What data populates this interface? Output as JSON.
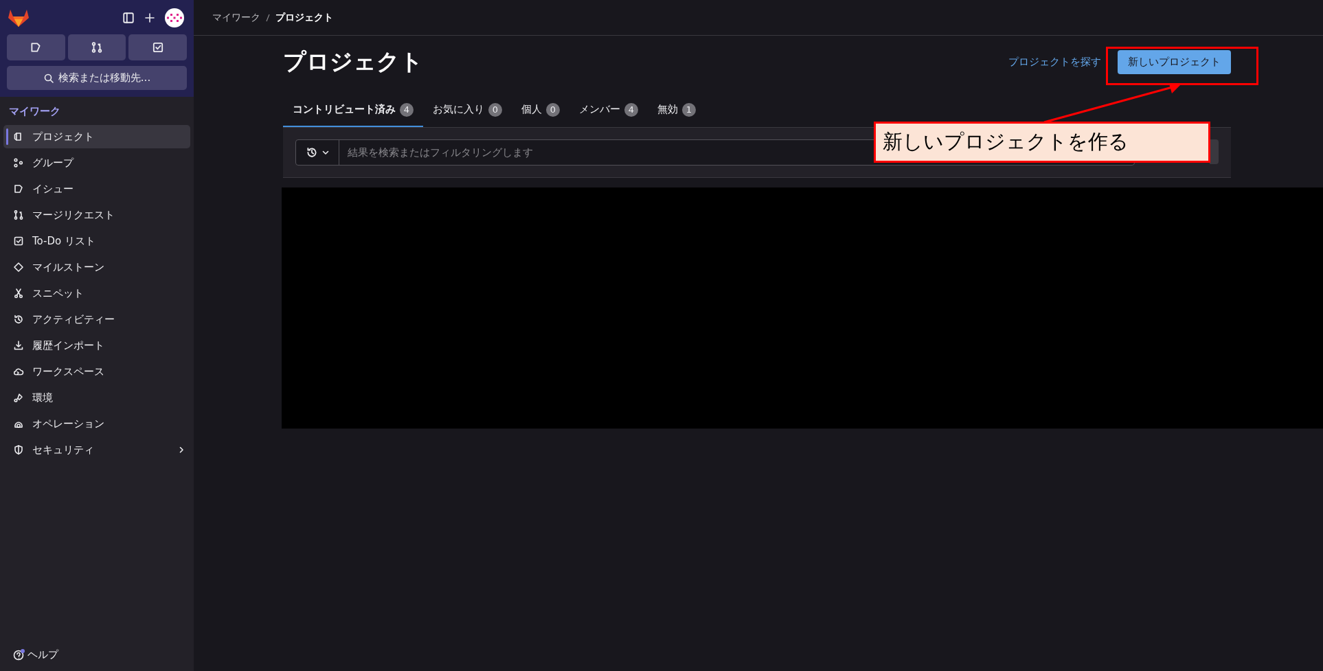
{
  "sidebar": {
    "search": {
      "label": "検索または移動先..."
    },
    "section_title": "マイワーク",
    "items": [
      {
        "label": "プロジェクト",
        "selected": true
      },
      {
        "label": "グループ",
        "selected": false
      },
      {
        "label": "イシュー",
        "selected": false
      },
      {
        "label": "マージリクエスト",
        "selected": false
      },
      {
        "label": "To-Do リスト",
        "selected": false
      },
      {
        "label": "マイルストーン",
        "selected": false
      },
      {
        "label": "スニペット",
        "selected": false
      },
      {
        "label": "アクティビティー",
        "selected": false
      },
      {
        "label": "履歴インポート",
        "selected": false
      },
      {
        "label": "ワークスペース",
        "selected": false
      },
      {
        "label": "環境",
        "selected": false
      },
      {
        "label": "オペレーション",
        "selected": false
      },
      {
        "label": "セキュリティ",
        "selected": false,
        "expandable": true
      }
    ],
    "help": "ヘルプ"
  },
  "breadcrumb": [
    "マイワーク",
    "プロジェクト"
  ],
  "page_title": "プロジェクト",
  "explore_link": "プロジェクトを探す",
  "new_button": "新しいプロジェクト",
  "tabs": [
    {
      "label": "コントリビュート済み",
      "count": "4",
      "selected": true
    },
    {
      "label": "お気に入り",
      "count": "0",
      "selected": false
    },
    {
      "label": "個人",
      "count": "0",
      "selected": false
    },
    {
      "label": "メンバー",
      "count": "4",
      "selected": false
    },
    {
      "label": "無効",
      "count": "1",
      "selected": false
    }
  ],
  "filter": {
    "placeholder": "結果を検索またはフィルタリングします"
  },
  "callout": {
    "text": "新しいプロジェクトを作る"
  }
}
